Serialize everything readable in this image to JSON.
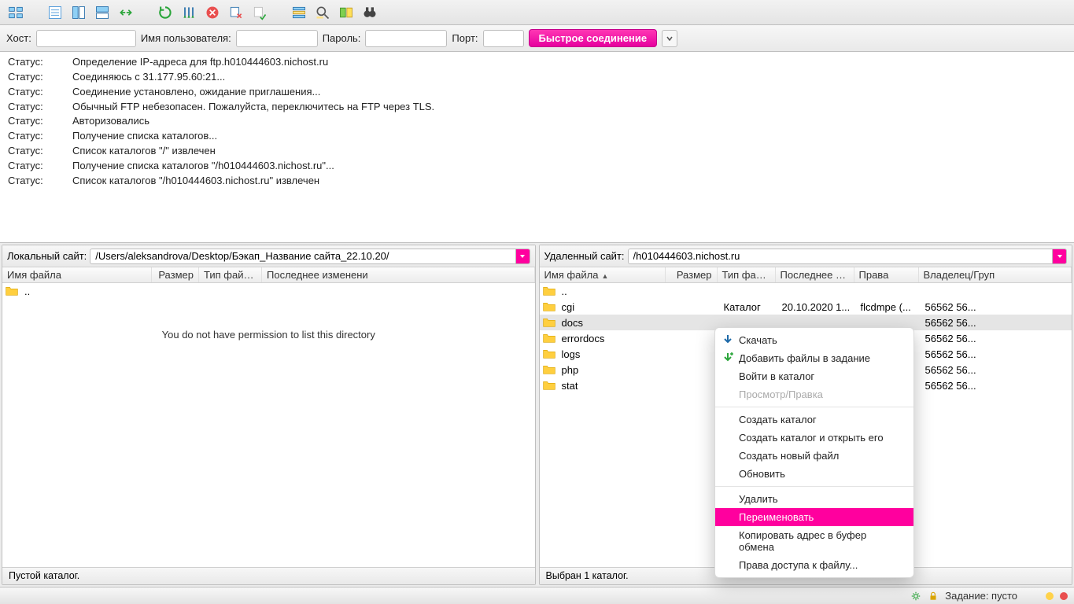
{
  "quickconnect": {
    "host_label": "Хост:",
    "user_label": "Имя пользователя:",
    "pass_label": "Пароль:",
    "port_label": "Порт:",
    "button": "Быстрое соединение"
  },
  "log": [
    {
      "k": "Статус:",
      "v": "Определение IP-адреса для ftp.h010444603.nichost.ru"
    },
    {
      "k": "Статус:",
      "v": "Соединяюсь с 31.177.95.60:21..."
    },
    {
      "k": "Статус:",
      "v": "Соединение установлено, ожидание приглашения..."
    },
    {
      "k": "Статус:",
      "v": "Обычный FTP небезопасен. Пожалуйста, переключитесь на FTP через TLS."
    },
    {
      "k": "Статус:",
      "v": "Авторизовались"
    },
    {
      "k": "Статус:",
      "v": "Получение списка каталогов..."
    },
    {
      "k": "Статус:",
      "v": "Список каталогов \"/\" извлечен"
    },
    {
      "k": "Статус:",
      "v": "Получение списка каталогов \"/h010444603.nichost.ru\"..."
    },
    {
      "k": "Статус:",
      "v": "Список каталогов \"/h010444603.nichost.ru\" извлечен"
    }
  ],
  "local": {
    "label": "Локальный сайт:",
    "path": "/Users/aleksandrova/Desktop/Бэкап_Название сайта_22.10.20/",
    "columns": {
      "name": "Имя файла",
      "size": "Размер",
      "type": "Тип файла",
      "modified": "Последнее изменени"
    },
    "parent": "..",
    "empty": "You do not have permission to list this directory",
    "status": "Пустой каталог."
  },
  "remote": {
    "label": "Удаленный сайт:",
    "path": "/h010444603.nichost.ru",
    "columns": {
      "name": "Имя файла",
      "size": "Размер",
      "type": "Тип файла",
      "modified": "Последнее измен",
      "perms": "Права",
      "owner": "Владелец/Груп"
    },
    "rows": [
      {
        "name": "..",
        "size": "",
        "type": "",
        "modified": "",
        "perms": "",
        "owner": ""
      },
      {
        "name": "cgi",
        "size": "",
        "type": "Каталог",
        "modified": "20.10.2020 1...",
        "perms": "flcdmpe (...",
        "owner": "56562 56..."
      },
      {
        "name": "docs",
        "size": "",
        "type": "",
        "modified": "",
        "perms": "",
        "owner": "56562 56...",
        "selected": true
      },
      {
        "name": "errordocs",
        "size": "",
        "type": "",
        "modified": "",
        "perms": "",
        "owner": "56562 56..."
      },
      {
        "name": "logs",
        "size": "",
        "type": "",
        "modified": "",
        "perms": "",
        "owner": "56562 56..."
      },
      {
        "name": "php",
        "size": "",
        "type": "",
        "modified": "",
        "perms": "",
        "owner": "56562 56..."
      },
      {
        "name": "stat",
        "size": "",
        "type": "",
        "modified": "",
        "perms": "",
        "owner": "56562 56..."
      }
    ],
    "status": "Выбран 1 каталог."
  },
  "context_menu": {
    "download": "Скачать",
    "add_to_queue": "Добавить файлы в задание",
    "enter": "Войти в каталог",
    "view_edit": "Просмотр/Правка",
    "mkdir": "Создать каталог",
    "mkdir_enter": "Создать каталог и открыть его",
    "newfile": "Создать новый файл",
    "refresh": "Обновить",
    "delete": "Удалить",
    "rename": "Переименовать",
    "copy_url": "Копировать адрес в буфер обмена",
    "perms": "Права доступа к файлу..."
  },
  "bottombar": {
    "queue": "Задание: пусто"
  }
}
